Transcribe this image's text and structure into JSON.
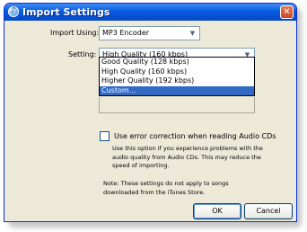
{
  "window": {
    "title": "Import Settings",
    "close_symbol": "✕"
  },
  "import_using": {
    "label": "Import Using:",
    "value": "MP3 Encoder"
  },
  "setting": {
    "label": "Setting:",
    "value": "High Quality (160 kbps)"
  },
  "dropdown": {
    "options": [
      "Good Quality (128 kbps)",
      "High Quality (160 kbps)",
      "Higher Quality (192 kbps)",
      "Custom..."
    ],
    "highlighted": "Custom..."
  },
  "error_correction": {
    "checked": false,
    "label": "Use error correction when reading Audio CDs",
    "description": [
      "Use this option if you experience problems with the",
      "audio quality from Audio CDs.  This may reduce the",
      "speed of importing."
    ]
  },
  "note": [
    "Note: These settings do not apply to songs",
    "downloaded from the iTunes Store."
  ],
  "buttons": {
    "ok": "OK",
    "cancel": "Cancel"
  }
}
